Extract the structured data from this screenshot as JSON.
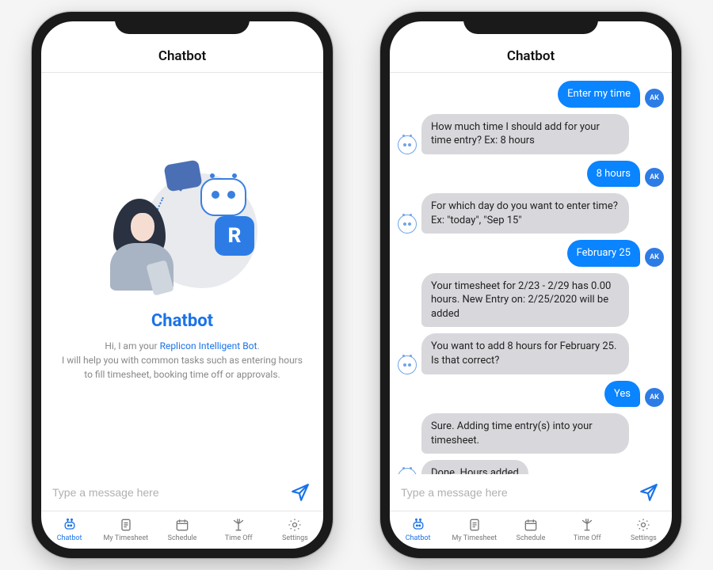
{
  "app_title": "Chatbot",
  "accent_color": "#1a73e8",
  "intro": {
    "title": "Chatbot",
    "text_prefix": "Hi, I am your ",
    "text_highlight": "Replicon Intelligent Bot",
    "text_suffix": ".",
    "text_line2": "I will help you with common tasks such as entering hours to fill timesheet, booking time off or approvals.",
    "badge_letter": "R"
  },
  "input": {
    "placeholder": "Type a message here"
  },
  "user_avatar": "AK",
  "messages": [
    {
      "from": "user",
      "text": "Enter my time"
    },
    {
      "from": "bot",
      "text": "How much time I should add for your time entry? Ex: 8 hours"
    },
    {
      "from": "user",
      "text": "8 hours"
    },
    {
      "from": "bot",
      "text": "For which day do you want to enter time? Ex: \"today\", \"Sep 15\""
    },
    {
      "from": "user",
      "text": "February 25"
    },
    {
      "from": "bot",
      "text": "Your timesheet for 2/23 - 2/29 has 0.00 hours. New Entry on: 2/25/2020 will be added"
    },
    {
      "from": "bot",
      "text": "You want to add 8 hours for February 25. Is that correct?"
    },
    {
      "from": "user",
      "text": "Yes"
    },
    {
      "from": "bot",
      "text": "Sure. Adding time entry(s) into your timesheet."
    },
    {
      "from": "bot",
      "text": "Done. Hours added"
    }
  ],
  "tabs": [
    {
      "id": "chatbot",
      "label": "Chatbot",
      "icon": "bot",
      "active": true
    },
    {
      "id": "timesheet",
      "label": "My Timesheet",
      "icon": "sheet",
      "active": false
    },
    {
      "id": "schedule",
      "label": "Schedule",
      "icon": "calendar",
      "active": false
    },
    {
      "id": "timeoff",
      "label": "Time Off",
      "icon": "palm",
      "active": false
    },
    {
      "id": "settings",
      "label": "Settings",
      "icon": "gear",
      "active": false
    }
  ]
}
